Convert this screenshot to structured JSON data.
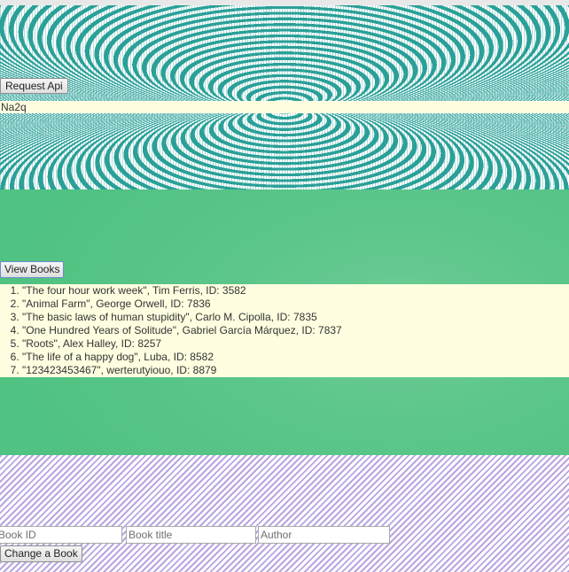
{
  "api": {
    "request_button_label": "Request Api",
    "result_text": "Na2q"
  },
  "books": {
    "view_button_label": "View Books",
    "items": [
      "\"The four hour work week\", Tim Ferris, ID: 3582",
      "\"Animal Farm\", George Orwell, ID: 7836",
      "\"The basic laws of human stupidity\", Carlo M. Cipolla, ID: 7835",
      "\"One Hundred Years of Solitude\", Gabriel García Márquez, ID: 7837",
      "\"Roots\", Alex Halley, ID: 8257",
      "\"The life of a happy dog\", Luba, ID: 8582",
      "\"123423453467\", werterutyiouo, ID: 8879"
    ]
  },
  "change_form": {
    "book_id_placeholder": "Book ID",
    "book_title_placeholder": "Book title",
    "author_placeholder": "Author",
    "book_id_value": "",
    "book_title_value": "",
    "author_value": "",
    "submit_label": "Change a Book"
  },
  "colors": {
    "pattern_teal": "#2aa098",
    "section_green": "#5cc68a",
    "result_background": "#fffee0",
    "stripe_purple": "#b9a5e2"
  }
}
